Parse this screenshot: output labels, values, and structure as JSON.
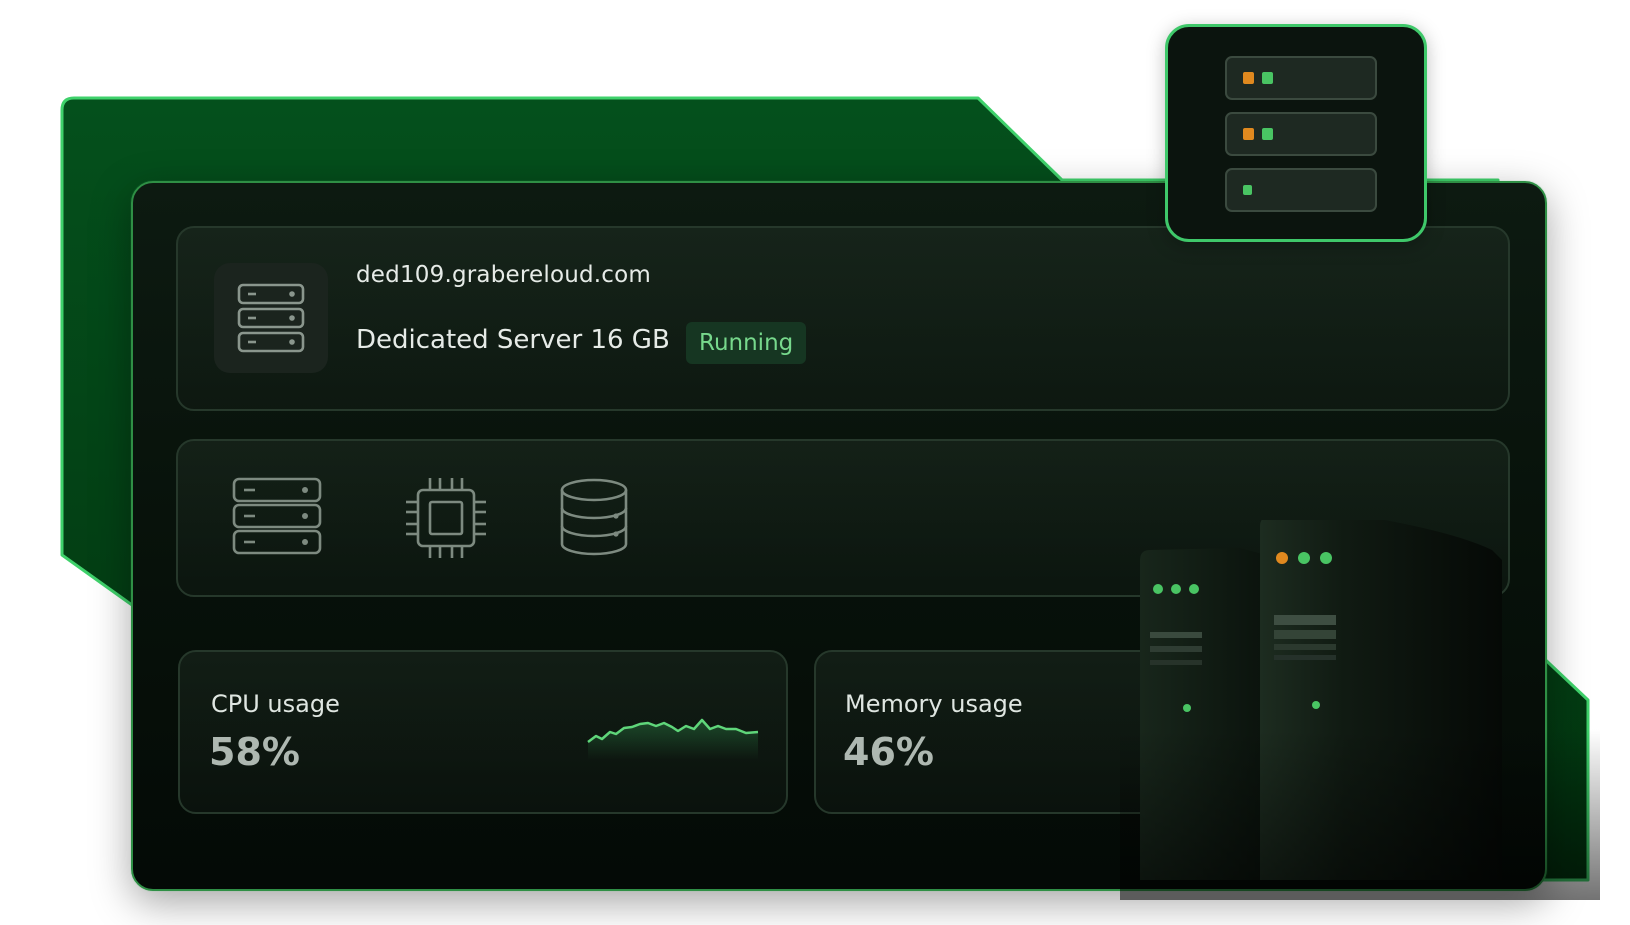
{
  "server": {
    "hostname": "ded109.grabereloud.com",
    "plan": "Dedicated Server 16 GB",
    "status": "Running",
    "icon": "server-icon"
  },
  "features": [
    {
      "icon": "server-rack-icon"
    },
    {
      "icon": "cpu-chip-icon"
    },
    {
      "icon": "database-icon"
    }
  ],
  "metrics": {
    "cpu": {
      "label": "CPU usage",
      "value": "58%",
      "percent": 58
    },
    "memory": {
      "label": "Memory usage",
      "value": "46%",
      "percent": 46
    }
  },
  "colors": {
    "accent": "#3fc86a",
    "status_green": "#77d88c",
    "led_orange": "#e0891f",
    "led_green": "#49c463",
    "panel_bg": "#0b140e"
  }
}
